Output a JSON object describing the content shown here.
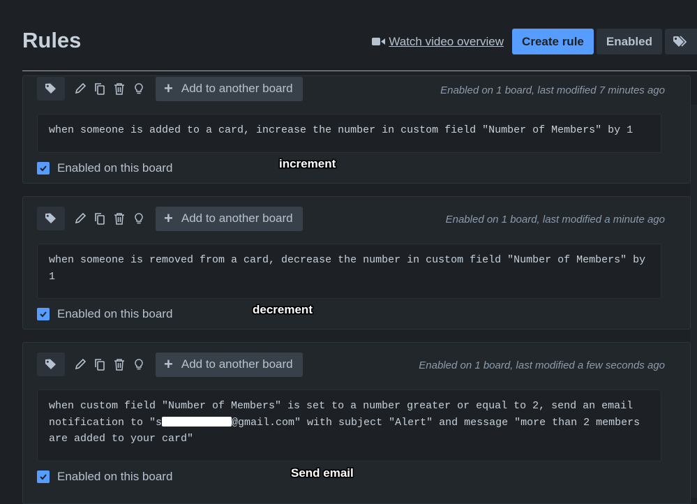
{
  "header": {
    "title": "Rules",
    "watch_video_label": "Watch video overview",
    "create_rule_label": "Create rule",
    "enabled_filter_label": "Enabled"
  },
  "rules": [
    {
      "add_board_label": "Add to another board",
      "meta": "Enabled on 1 board, last modified 7 minutes ago",
      "text": "when someone is added to a card, increase the number in custom field \"Number of Members\" by 1",
      "enabled_label": "Enabled on this board",
      "enabled": true,
      "annotation": "increment"
    },
    {
      "add_board_label": "Add to another board",
      "meta": "Enabled on 1 board, last modified a minute ago",
      "text": "when someone is removed from a card, decrease the number in custom field \"Number of Members\" by 1",
      "enabled_label": "Enabled on this board",
      "enabled": true,
      "annotation": "decrement"
    },
    {
      "add_board_label": "Add to another board",
      "meta": "Enabled on 1 board, last modified a few seconds ago",
      "text_before_redaction": "when custom field \"Number of Members\" is set to a number greater or equal to 2, send an email notification to \"s",
      "text_after_redaction": "@gmail.com\" with subject \"Alert\" and message \"more than 2 members are added to your card\"",
      "enabled_label": "Enabled on this board",
      "enabled": true,
      "annotation": "Send email"
    }
  ],
  "icons": {
    "watch_video": "video-camera-icon",
    "tags": "tag-icon",
    "edit": "pencil-icon",
    "copy": "copy-icon",
    "delete": "trash-icon",
    "insight": "lightbulb-icon",
    "add": "plus-icon",
    "checkbox": "checkmark-icon"
  },
  "colors": {
    "background": "#1d2125",
    "card": "#22272b",
    "primary_button": "#579dff",
    "checkbox": "#579dff"
  }
}
